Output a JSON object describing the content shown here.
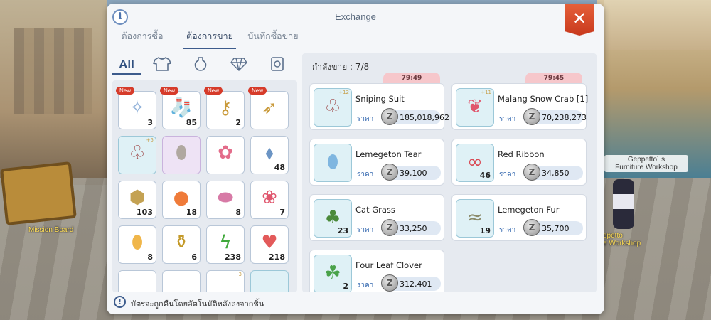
{
  "scene": {
    "board_label": "Mission Board",
    "npc_tag_line1": "Geppetto´ s",
    "npc_tag_line2": "Furniture Workshop",
    "npc_tag2_line1": "epetto",
    "npc_tag2_line2": "e Workshop"
  },
  "dialog": {
    "title": "Exchange",
    "info_label": "i",
    "close_label": "✕",
    "tabs": [
      {
        "label": "ต้องการซื้อ",
        "active": false
      },
      {
        "label": "ต้องการขาย",
        "active": true
      },
      {
        "label": "บันทึกซื้อขาย",
        "active": false
      }
    ],
    "categories": [
      {
        "label": "All",
        "icon": "all"
      },
      {
        "label": "",
        "icon": "shirt-icon"
      },
      {
        "label": "",
        "icon": "potion-icon"
      },
      {
        "label": "",
        "icon": "gem-icon"
      },
      {
        "label": "",
        "icon": "card-icon"
      }
    ],
    "notice_icon": "!",
    "notice": "บัตรจะถูกคืนโดยอัตโนมัติหลังลงจากชิ้น"
  },
  "inventory": [
    {
      "icon": "feather-icon",
      "glyph": "✧",
      "color": "#8fb0d8",
      "qty": "3",
      "new": "New",
      "bg": "white"
    },
    {
      "icon": "christmas-stocking-icon",
      "glyph": "🧦",
      "color": "#d43a3a",
      "qty": "85",
      "new": "New",
      "bg": "white"
    },
    {
      "icon": "key-icon",
      "glyph": "⚷",
      "color": "#c99a3b",
      "qty": "2",
      "new": "New",
      "bg": "white"
    },
    {
      "icon": "wing-staff-icon",
      "glyph": "➶",
      "color": "#c99a3b",
      "qty": "",
      "new": "New",
      "bg": "white"
    },
    {
      "icon": "sniping-suit-icon",
      "glyph": "♧",
      "color": "#9b3f3f",
      "qty": "",
      "new": "",
      "bg": "blue",
      "refine": "+5"
    },
    {
      "icon": "silver-leaf-icon",
      "glyph": "⬮",
      "color": "#b0a8a0",
      "qty": "",
      "new": "",
      "bg": "purple"
    },
    {
      "icon": "rose-icon",
      "glyph": "✿",
      "color": "#e36c8a",
      "qty": "",
      "new": "",
      "bg": "white"
    },
    {
      "icon": "crystal-icon",
      "glyph": "⬧",
      "color": "#6b94c4",
      "qty": "48",
      "new": "",
      "bg": "white"
    },
    {
      "icon": "leopard-bag-icon",
      "glyph": "⬢",
      "color": "#c4a253",
      "qty": "103",
      "new": "",
      "bg": "white"
    },
    {
      "icon": "apple-juice-icon",
      "glyph": "●",
      "color": "#ef7b3a",
      "qty": "18",
      "new": "",
      "bg": "white"
    },
    {
      "icon": "pink-bud-icon",
      "glyph": "⬬",
      "color": "#d77aa6",
      "qty": "8",
      "new": "",
      "bg": "white"
    },
    {
      "icon": "candy-icon",
      "glyph": "❀",
      "color": "#e0566d",
      "qty": "7",
      "new": "",
      "bg": "white"
    },
    {
      "icon": "mango-icon",
      "glyph": "⬮",
      "color": "#f0b64a",
      "qty": "8",
      "new": "",
      "bg": "white"
    },
    {
      "icon": "golden-vase-icon",
      "glyph": "⚱",
      "color": "#c49a2a",
      "qty": "6",
      "new": "",
      "bg": "white"
    },
    {
      "icon": "green-lightning-icon",
      "glyph": "ϟ",
      "color": "#3fa83a",
      "qty": "238",
      "new": "",
      "bg": "white"
    },
    {
      "icon": "heart-icon",
      "glyph": "♥",
      "color": "#e35a5a",
      "qty": "218",
      "new": "",
      "bg": "white"
    },
    {
      "icon": "partial-item-icon",
      "glyph": "",
      "color": "#f0d77a",
      "qty": "",
      "new": "",
      "bg": "white"
    },
    {
      "icon": "partial-item-icon",
      "glyph": "",
      "color": "#8fb0d8",
      "qty": "",
      "new": "",
      "bg": "white"
    },
    {
      "icon": "partial-item-icon",
      "glyph": "",
      "color": "#d45a5a",
      "qty": "",
      "new": "",
      "bg": "white",
      "refine": "3"
    },
    {
      "icon": "partial-item-icon",
      "glyph": "",
      "color": "#8fb0d8",
      "qty": "",
      "new": "",
      "bg": "blue"
    }
  ],
  "selling": {
    "label": "กำลังขาย : 7/8",
    "price_label": "ราคา",
    "coin_label": "Z",
    "items": [
      {
        "name": "Sniping Suit",
        "price": "185,018,962",
        "qty": "",
        "timer": "79:49",
        "refine": "+12",
        "icon": "sniping-suit-icon",
        "glyph": "♧",
        "color": "#9b3f3f"
      },
      {
        "name": "Malang Snow Crab [1]",
        "price": "70,238,273",
        "qty": "",
        "timer": "79:45",
        "refine": "+11",
        "icon": "snow-crab-icon",
        "glyph": "❦",
        "color": "#e0566d"
      },
      {
        "name": "Lemegeton Tear",
        "price": "39,100",
        "qty": "",
        "timer": "",
        "refine": "",
        "icon": "water-drop-icon",
        "glyph": "⬮",
        "color": "#7fb6e0"
      },
      {
        "name": "Red Ribbon",
        "price": "34,850",
        "qty": "46",
        "timer": "",
        "refine": "",
        "icon": "red-ribbon-icon",
        "glyph": "∞",
        "color": "#d94b56"
      },
      {
        "name": "Cat Grass",
        "price": "33,250",
        "qty": "23",
        "timer": "",
        "refine": "",
        "icon": "cat-grass-icon",
        "glyph": "♣",
        "color": "#4a8a3a"
      },
      {
        "name": "Lemegeton Fur",
        "price": "35,700",
        "qty": "19",
        "timer": "",
        "refine": "",
        "icon": "fur-icon",
        "glyph": "≈",
        "color": "#8a8a6a"
      },
      {
        "name": "Four Leaf Clover",
        "price": "312,401",
        "qty": "2",
        "timer": "",
        "refine": "",
        "icon": "four-leaf-clover-icon",
        "glyph": "☘",
        "color": "#4aa24a"
      }
    ]
  }
}
